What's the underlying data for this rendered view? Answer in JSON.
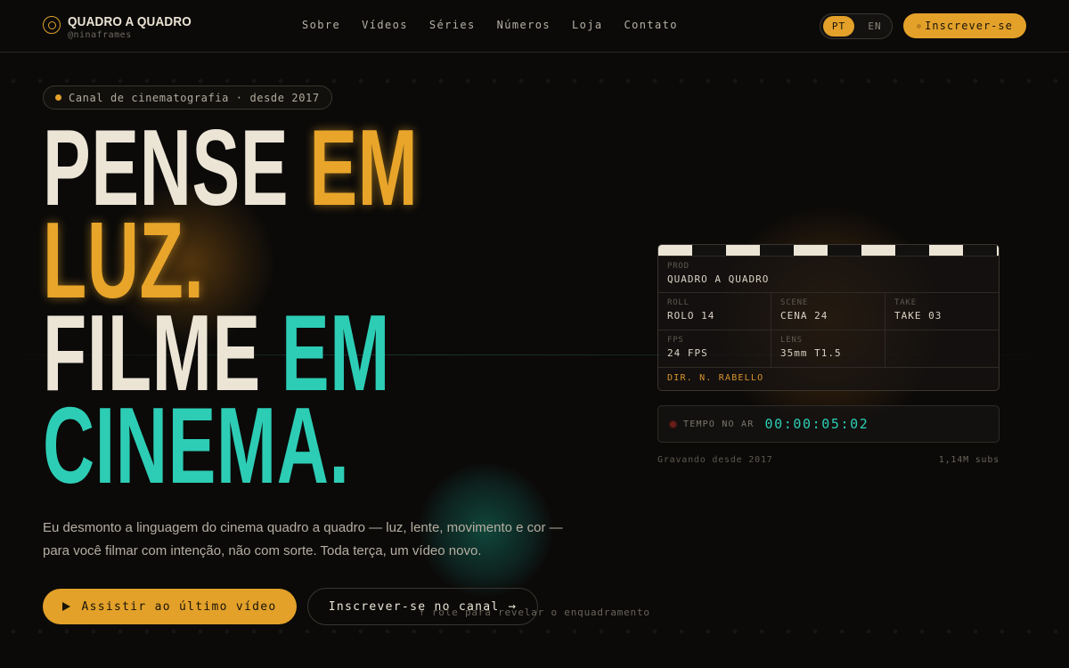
{
  "brand": {
    "name": "QUADRO A QUADRO",
    "handle": "@ninaframes",
    "icon": "aperture-icon"
  },
  "nav": {
    "items": [
      "Sobre",
      "Vídeos",
      "Séries",
      "Números",
      "Loja",
      "Contato"
    ]
  },
  "language": {
    "options": [
      "PT",
      "EN"
    ],
    "selected": "PT"
  },
  "header": {
    "subscribe_label": "Inscrever-se"
  },
  "hero": {
    "pill_text": "Canal de cinematografia · desde 2017",
    "headline": {
      "line1_a": "PENSE",
      "line1_b": "EM",
      "line2": "LUZ.",
      "line3_a": "FILME",
      "line3_b": "EM",
      "line4": "CINEMA."
    },
    "lede": "Eu desmonto a linguagem do cinema quadro a quadro — luz, lente, movimento e cor — para você filmar com intenção, não com sorte. Toda terça, um vídeo novo.",
    "primary_button": "Assistir ao último vídeo",
    "secondary_button": "Inscrever-se no canal",
    "hint": "↑ role para revelar o enquadramento"
  },
  "clapper": {
    "prod_label": "PROD",
    "prod_value": "QUADRO A QUADRO",
    "roll_label": "ROLL",
    "roll_value": "ROLO 14",
    "scene_label": "SCENE",
    "scene_value": "CENA 24",
    "take_label": "TAKE",
    "take_value": "TAKE 03",
    "fps_label": "FPS",
    "fps_value": "24 FPS",
    "lens_label": "LENS",
    "lens_value": "35mm T1.5",
    "director": "DIR. N. RABELLO"
  },
  "onair": {
    "label": "TEMPO NO AR",
    "time": "00:00:05:02"
  },
  "meta": {
    "since": "Gravando desde 2017",
    "subs": "1,14M subs"
  },
  "colors": {
    "accent": "#e3a12a",
    "teal": "#2dcdb5",
    "cream": "#ece5d6",
    "background": "#0b0a09"
  }
}
